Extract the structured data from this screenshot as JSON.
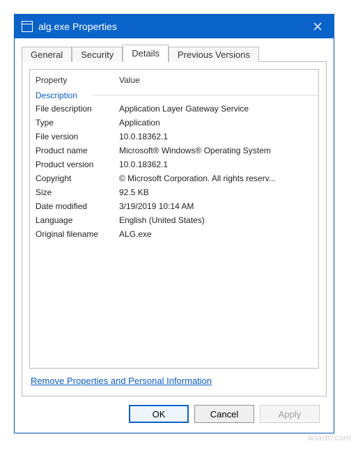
{
  "window": {
    "title": "alg.exe Properties"
  },
  "tabs": [
    {
      "label": "General",
      "active": false
    },
    {
      "label": "Security",
      "active": false
    },
    {
      "label": "Details",
      "active": true
    },
    {
      "label": "Previous Versions",
      "active": false
    }
  ],
  "details": {
    "columns": {
      "property": "Property",
      "value": "Value"
    },
    "section": "Description",
    "rows": [
      {
        "property": "File description",
        "value": "Application Layer Gateway Service"
      },
      {
        "property": "Type",
        "value": "Application"
      },
      {
        "property": "File version",
        "value": "10.0.18362.1"
      },
      {
        "property": "Product name",
        "value": "Microsoft® Windows® Operating System"
      },
      {
        "property": "Product version",
        "value": "10.0.18362.1"
      },
      {
        "property": "Copyright",
        "value": "© Microsoft Corporation. All rights reserv..."
      },
      {
        "property": "Size",
        "value": "92.5 KB"
      },
      {
        "property": "Date modified",
        "value": "3/19/2019 10:14 AM"
      },
      {
        "property": "Language",
        "value": "English (United States)"
      },
      {
        "property": "Original filename",
        "value": "ALG.exe"
      }
    ],
    "link": "Remove Properties and Personal Information"
  },
  "buttons": {
    "ok": "OK",
    "cancel": "Cancel",
    "apply": "Apply"
  },
  "watermark": "wsxdn.com"
}
